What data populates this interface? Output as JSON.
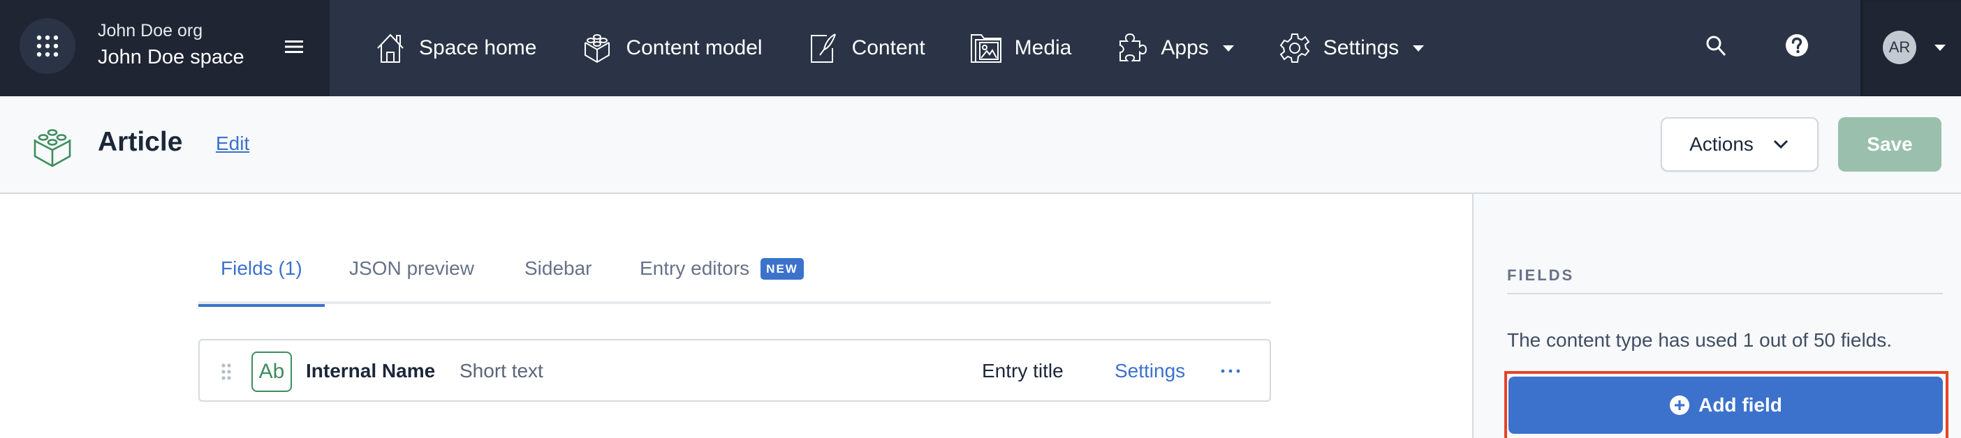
{
  "topnav": {
    "org_name": "John Doe org",
    "space_name": "John Doe space",
    "items": [
      {
        "label": "Space home",
        "icon": "home-icon",
        "has_dropdown": false
      },
      {
        "label": "Content model",
        "icon": "content-model-icon",
        "has_dropdown": false
      },
      {
        "label": "Content",
        "icon": "content-icon",
        "has_dropdown": false
      },
      {
        "label": "Media",
        "icon": "media-icon",
        "has_dropdown": false
      },
      {
        "label": "Apps",
        "icon": "puzzle-icon",
        "has_dropdown": true
      },
      {
        "label": "Settings",
        "icon": "gear-icon",
        "has_dropdown": true
      }
    ],
    "avatar_initials": "AR"
  },
  "header": {
    "title": "Article",
    "edit_label": "Edit",
    "actions_label": "Actions",
    "save_label": "Save"
  },
  "tabs": [
    {
      "label": "Fields (1)",
      "active": true
    },
    {
      "label": "JSON preview",
      "active": false
    },
    {
      "label": "Sidebar",
      "active": false
    },
    {
      "label": "Entry editors",
      "active": false,
      "badge": "NEW"
    }
  ],
  "fields": [
    {
      "type_icon_text": "Ab",
      "name": "Internal Name",
      "type": "Short text",
      "role": "Entry title",
      "settings_label": "Settings"
    }
  ],
  "sidebar": {
    "heading": "FIELDS",
    "usage_text": "The content type has used 1 out of 50 fields.",
    "add_field_label": "Add field"
  },
  "colors": {
    "nav_bg": "#2a3446",
    "nav_dark": "#1f2533",
    "primary": "#3c72cc",
    "positive_disabled": "#9ac0ad",
    "content_type_green": "#3e8c5e",
    "highlight": "#e5432a"
  }
}
